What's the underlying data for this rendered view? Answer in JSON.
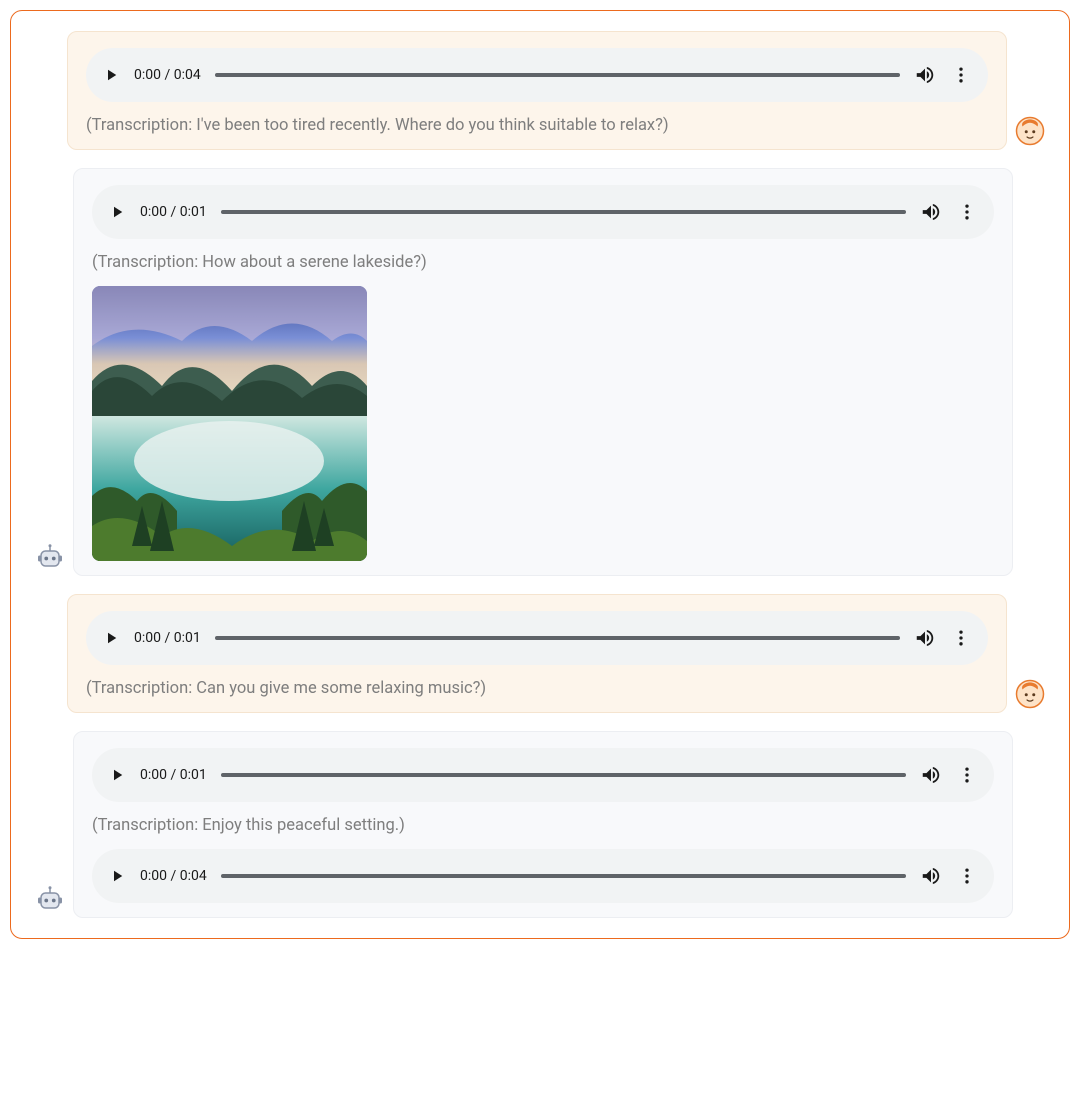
{
  "messages": [
    {
      "role": "user",
      "audio": [
        {
          "current": "0:00",
          "total": "0:04"
        }
      ],
      "transcription": "(Transcription: I've been too tired recently. Where do you think suitable to relax?)",
      "image": null
    },
    {
      "role": "bot",
      "audio": [
        {
          "current": "0:00",
          "total": "0:01"
        }
      ],
      "transcription": "(Transcription: How about a serene lakeside?)",
      "image": "lakeside-scene"
    },
    {
      "role": "user",
      "audio": [
        {
          "current": "0:00",
          "total": "0:01"
        }
      ],
      "transcription": "(Transcription: Can you give me some relaxing music?)",
      "image": null
    },
    {
      "role": "bot",
      "audio": [
        {
          "current": "0:00",
          "total": "0:01"
        },
        {
          "current": "0:00",
          "total": "0:04"
        }
      ],
      "transcription": "(Transcription: Enjoy this peaceful setting.)",
      "image": null
    }
  ],
  "time_separator": " / "
}
